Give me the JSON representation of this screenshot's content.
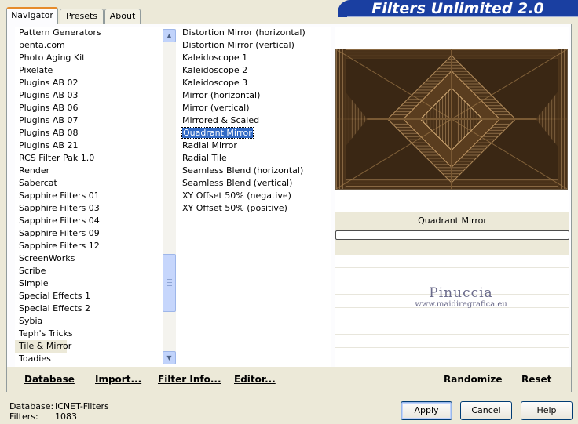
{
  "window": {
    "title": "Filters Unlimited 2.0"
  },
  "tabs": [
    {
      "label": "Navigator",
      "active": true
    },
    {
      "label": "Presets",
      "active": false
    },
    {
      "label": "About",
      "active": false
    }
  ],
  "categories": {
    "items": [
      "Pattern Generators",
      "penta.com",
      "Photo Aging Kit",
      "Pixelate",
      "Plugins AB 02",
      "Plugins AB 03",
      "Plugins AB 06",
      "Plugins AB 07",
      "Plugins AB 08",
      "Plugins AB 21",
      "RCS Filter Pak 1.0",
      "Render",
      "Sabercat",
      "Sapphire Filters 01",
      "Sapphire Filters 03",
      "Sapphire Filters 04",
      "Sapphire Filters 09",
      "Sapphire Filters 12",
      "ScreenWorks",
      "Scribe",
      "Simple",
      "Special Effects 1",
      "Special Effects 2",
      "Sybia",
      "Teph's Tricks",
      "Tile & Mirror",
      "Toadies"
    ],
    "selected": "Tile & Mirror"
  },
  "filters": {
    "items": [
      "Distortion Mirror (horizontal)",
      "Distortion Mirror (vertical)",
      "Kaleidoscope 1",
      "Kaleidoscope 2",
      "Kaleidoscope 3",
      "Mirror (horizontal)",
      "Mirror (vertical)",
      "Mirrored & Scaled",
      "Quadrant Mirror",
      "Radial Mirror",
      "Radial Tile",
      "Seamless Blend (horizontal)",
      "Seamless Blend (vertical)",
      "XY Offset 50% (negative)",
      "XY Offset 50% (positive)"
    ],
    "selected": "Quadrant Mirror"
  },
  "preview": {
    "filter_name": "Quadrant Mirror",
    "watermark_name": "Pinuccia",
    "watermark_url": "www.maidiregrafica.eu"
  },
  "toolbar": {
    "database": "Database",
    "import": "Import...",
    "filter_info": "Filter Info...",
    "editor": "Editor...",
    "randomize": "Randomize",
    "reset": "Reset"
  },
  "status": {
    "database_label": "Database:",
    "database_value": "ICNET-Filters",
    "filters_label": "Filters:",
    "filters_value": "1083"
  },
  "buttons": {
    "apply": "Apply",
    "cancel": "Cancel",
    "help": "Help"
  },
  "colors": {
    "selection": "#316ac5",
    "title_bar": "#1a3fa1",
    "dialog_bg": "#ece9d8"
  }
}
